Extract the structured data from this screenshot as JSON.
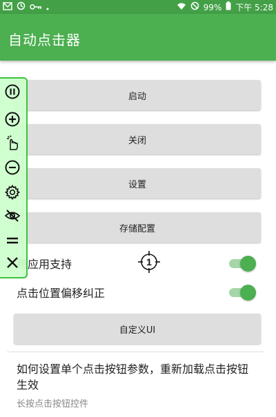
{
  "status_bar": {
    "battery": "99%",
    "time": "下午 5:28"
  },
  "app_bar": {
    "title": "自动点击器"
  },
  "buttons": {
    "start": "启动",
    "close": "关闭",
    "settings": "设置",
    "save_config": "存储配置",
    "custom_ui": "自定义UI"
  },
  "toggles": [
    {
      "label": "跨应用支持",
      "on": true
    },
    {
      "label": "点击位置偏移纠正",
      "on": true
    }
  ],
  "help": {
    "title": "如何设置单个点击按钮参数，重新加载点击按钮生效",
    "subtitle": "长按点击按钮控件"
  },
  "crosshair": {
    "number": "1"
  },
  "colors": {
    "primary": "#4caf50",
    "status_bar": "#43a047",
    "float_panel_border": "#3cc33c"
  }
}
